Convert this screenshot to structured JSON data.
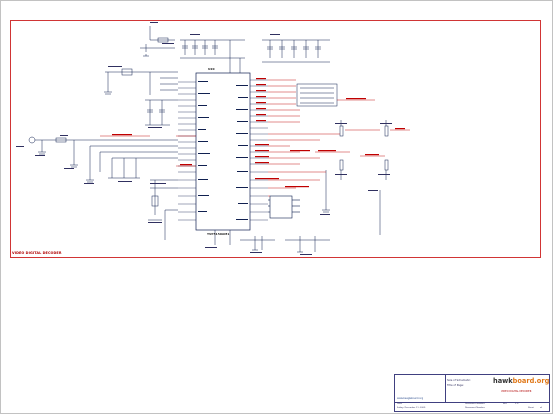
{
  "sheet": {
    "title": "VIDEO DIGITAL DECODER",
    "main_ic_ref": "U20",
    "main_ic_part": "TVP5150AM1"
  },
  "title_block": {
    "site_url": "www.beagleboard.org",
    "label_size": "Size of Schematic:",
    "label_title": "Title of Page:",
    "brand_part1": "hawk",
    "brand_part2": "board.org",
    "page_title": "VIDEO DIGITAL DECODER",
    "row_date_label": "Date",
    "row_date_value": "Friday, December 11, 2009",
    "row_doc_label": "Document Number",
    "row_doc_value": "Document Number",
    "row_rev_label": "Rev",
    "row_rev_value": "2.0",
    "row_sheet_label": "Sheet",
    "row_sheet_value": "of"
  },
  "colors": {
    "border": "#cc2020",
    "wire": "#202060",
    "net_label": "#c00000",
    "component": "#102050",
    "title_block": "#404080",
    "brand_orange": "#e07818"
  }
}
